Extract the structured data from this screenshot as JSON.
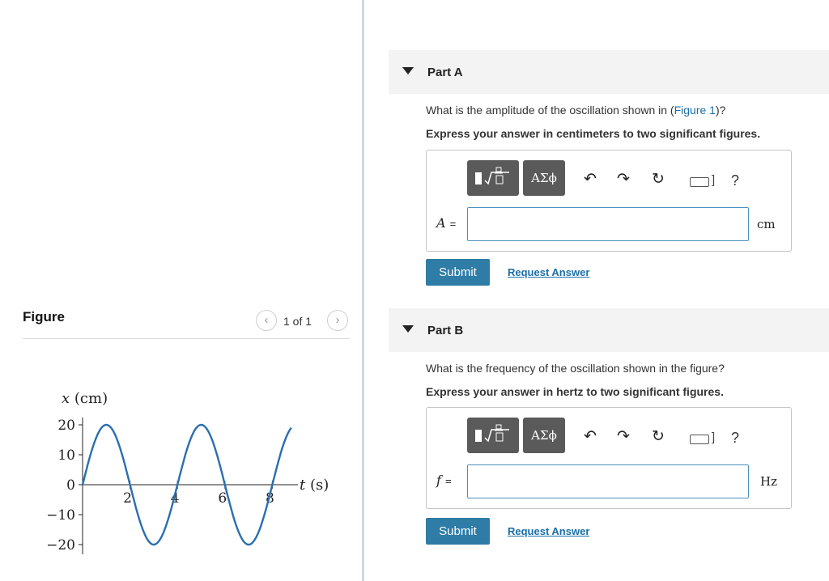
{
  "figure": {
    "title": "Figure",
    "pager": {
      "prev_icon": "chevron-left-icon",
      "next_icon": "chevron-right-icon",
      "text": "1 of 1"
    }
  },
  "chart_data": {
    "type": "line",
    "xlabel": "t (s)",
    "ylabel": "x (cm)",
    "x_ticks": [
      "2",
      "4",
      "6",
      "8"
    ],
    "y_ticks": [
      "20",
      "10",
      "0",
      "−10",
      "−20"
    ],
    "xlim": [
      0,
      8.8
    ],
    "ylim": [
      -20,
      20
    ],
    "series": [
      {
        "function": "x = 20 sin(2π t / 4)",
        "amplitude": 20,
        "period": 4,
        "t_range": [
          0,
          8.8
        ]
      }
    ],
    "grid": false
  },
  "partA": {
    "title": "Part A",
    "question_prefix": "What is the amplitude of the oscillation shown in (",
    "question_link": "Figure 1",
    "question_suffix": ")?",
    "instruction": "Express your answer in centimeters to two significant figures.",
    "toolbar": {
      "greek": "ΑΣϕ",
      "help": "?"
    },
    "variable": "A",
    "equals": "=",
    "unit": "cm",
    "submit": "Submit",
    "request": "Request Answer"
  },
  "partB": {
    "title": "Part B",
    "question": "What is the frequency of the oscillation shown in the figure?",
    "instruction": "Express your answer in hertz to two significant figures.",
    "toolbar": {
      "greek": "ΑΣϕ",
      "help": "?"
    },
    "variable": "f",
    "equals": "=",
    "unit": "Hz",
    "submit": "Submit",
    "request": "Request Answer"
  }
}
